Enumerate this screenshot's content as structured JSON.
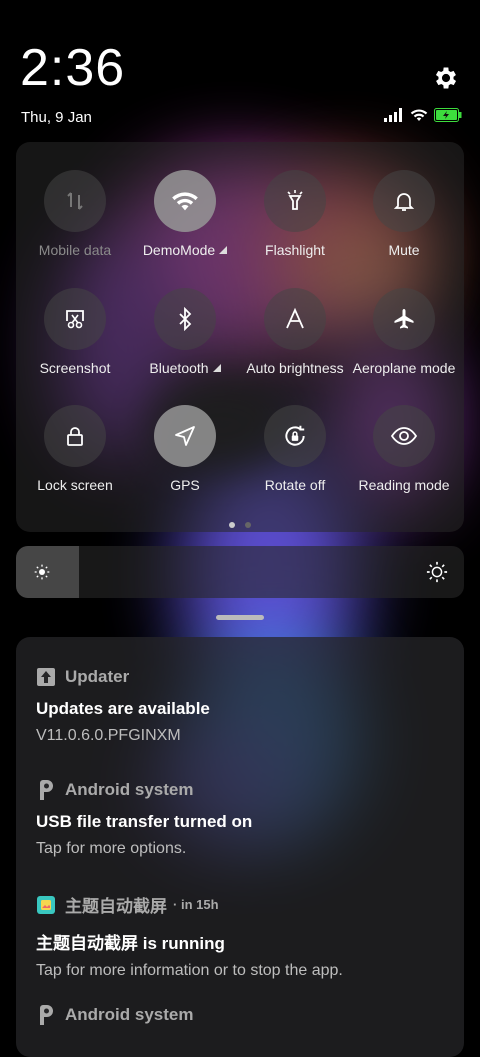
{
  "status_bar": {
    "time": "2:36",
    "date": "Thu, 9 Jan"
  },
  "quick_settings": {
    "tiles": [
      {
        "label": "Mobile data",
        "icon": "mobile-data-icon",
        "state": "off"
      },
      {
        "label": "DemoMode",
        "icon": "wifi-icon",
        "state": "on",
        "has_submenu": true
      },
      {
        "label": "Flashlight",
        "icon": "flashlight-icon",
        "state": "off"
      },
      {
        "label": "Mute",
        "icon": "bell-icon",
        "state": "off"
      },
      {
        "label": "Screenshot",
        "icon": "screenshot-icon",
        "state": "off"
      },
      {
        "label": "Bluetooth",
        "icon": "bluetooth-icon",
        "state": "off",
        "has_submenu": true
      },
      {
        "label": "Auto brightness",
        "icon": "auto-brightness-icon",
        "state": "off"
      },
      {
        "label": "Aeroplane mode",
        "icon": "airplane-icon",
        "state": "off"
      },
      {
        "label": "Lock screen",
        "icon": "lock-icon",
        "state": "off"
      },
      {
        "label": "GPS",
        "icon": "location-arrow-icon",
        "state": "on"
      },
      {
        "label": "Rotate off",
        "icon": "rotate-lock-icon",
        "state": "off"
      },
      {
        "label": "Reading mode",
        "icon": "eye-icon",
        "state": "off"
      }
    ],
    "page_count": 2,
    "active_page": 1
  },
  "brightness": {
    "level": 0.14
  },
  "notifications": [
    {
      "app": "Updater",
      "icon": "updater-icon",
      "time": "",
      "title": "Updates are available",
      "text": "V11.0.6.0.PFGINXM"
    },
    {
      "app": "Android system",
      "icon": "android-system-icon",
      "time": "",
      "title": "USB file transfer turned on",
      "text": "Tap for more options."
    },
    {
      "app": "主题自动截屏",
      "icon": "theme-app-icon",
      "time": "in 15h",
      "title": "主题自动截屏 is running",
      "text": "Tap for more information or to stop the app."
    },
    {
      "app": "Android system",
      "icon": "android-system-icon",
      "time": "",
      "title": "",
      "text": ""
    }
  ],
  "colors": {
    "panel": "#282828",
    "tile_on": "#969696",
    "battery": "#3ddc3d"
  }
}
